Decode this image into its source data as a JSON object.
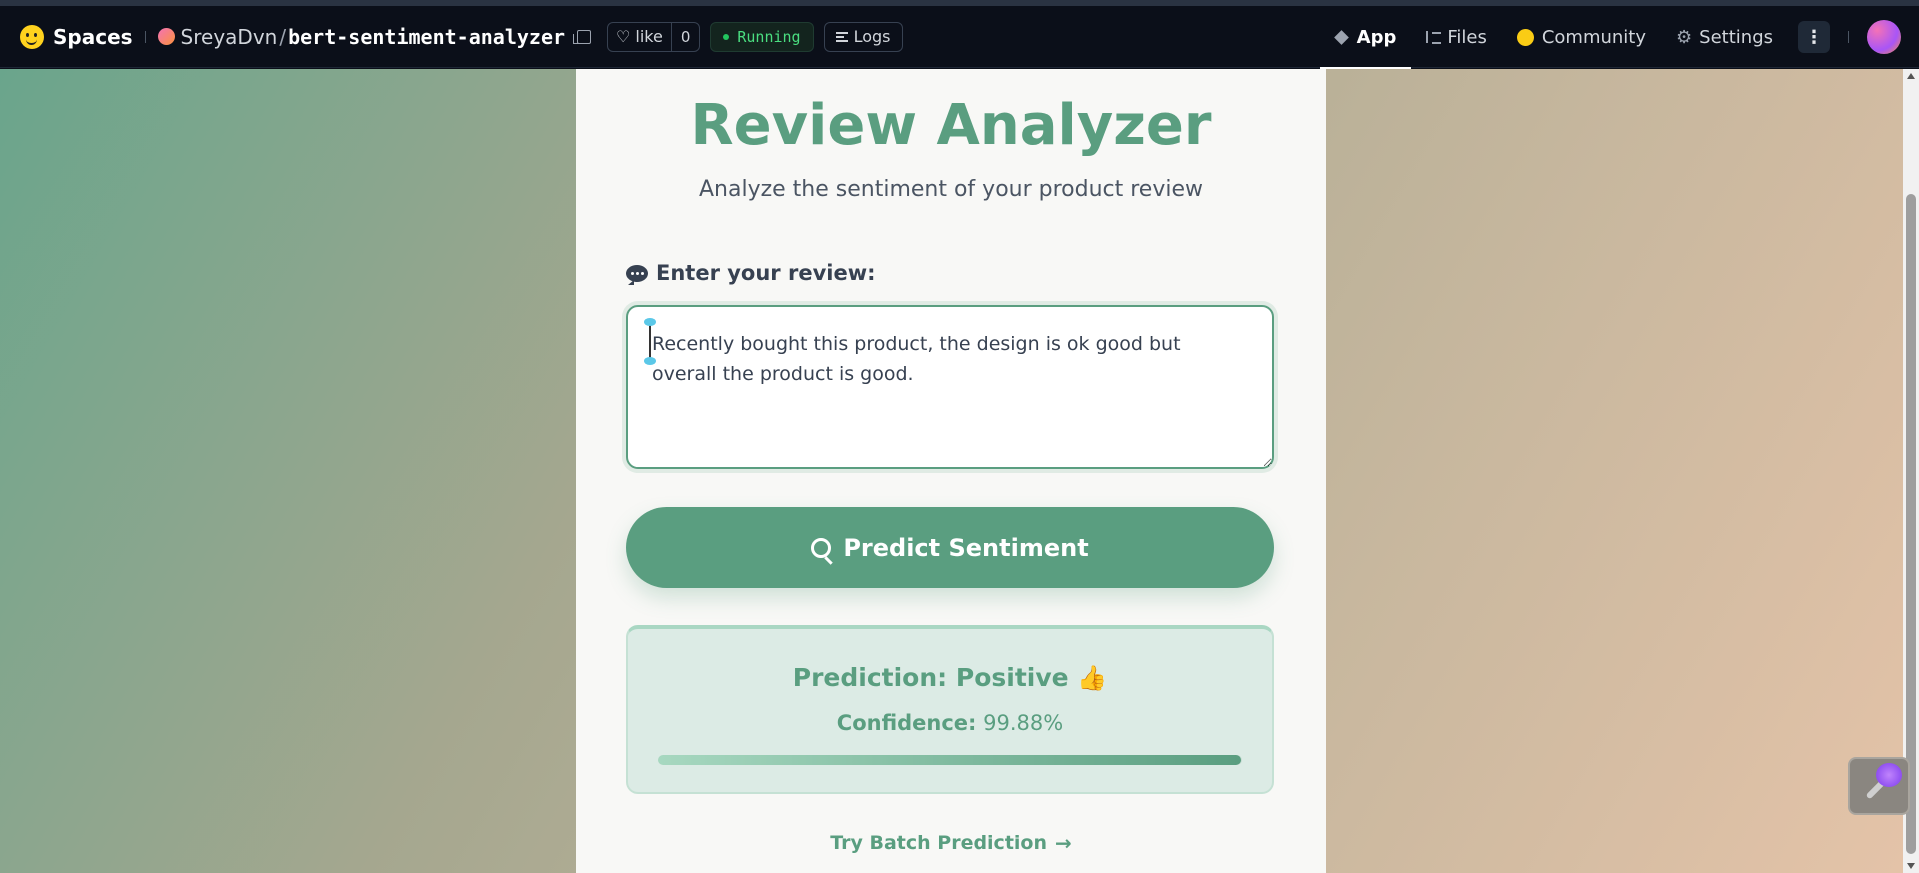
{
  "header": {
    "brand": "Spaces",
    "owner": "SreyaDvn",
    "separator": "/",
    "repo": "bert-sentiment-analyzer",
    "like_label": "like",
    "like_count": "0",
    "status": "Running",
    "logs": "Logs",
    "nav": [
      {
        "label": "App",
        "icon": "cube-icon"
      },
      {
        "label": "Files",
        "icon": "files-icon"
      },
      {
        "label": "Community",
        "icon": "community-icon"
      },
      {
        "label": "Settings",
        "icon": "gear-icon"
      }
    ],
    "more": "⋮"
  },
  "app": {
    "title": "Review Analyzer",
    "subtitle": "Analyze the sentiment of your product review",
    "input_label": "Enter your review:",
    "review_text": "Recently bought this product, the design is ok good but overall the product is good.",
    "predict_button": "Predict Sentiment",
    "result": {
      "prediction_label": "Prediction:",
      "prediction_value": "Positive",
      "prediction_emoji": "👍",
      "confidence_label": "Confidence:",
      "confidence_value": "99.88%",
      "confidence_fraction": 0.9988
    },
    "batch_link": "Try Batch Prediction",
    "batch_arrow": "→"
  },
  "colors": {
    "accent": "#5a9e80",
    "header_bg": "#0b0f19",
    "status_green": "#4ade80"
  }
}
